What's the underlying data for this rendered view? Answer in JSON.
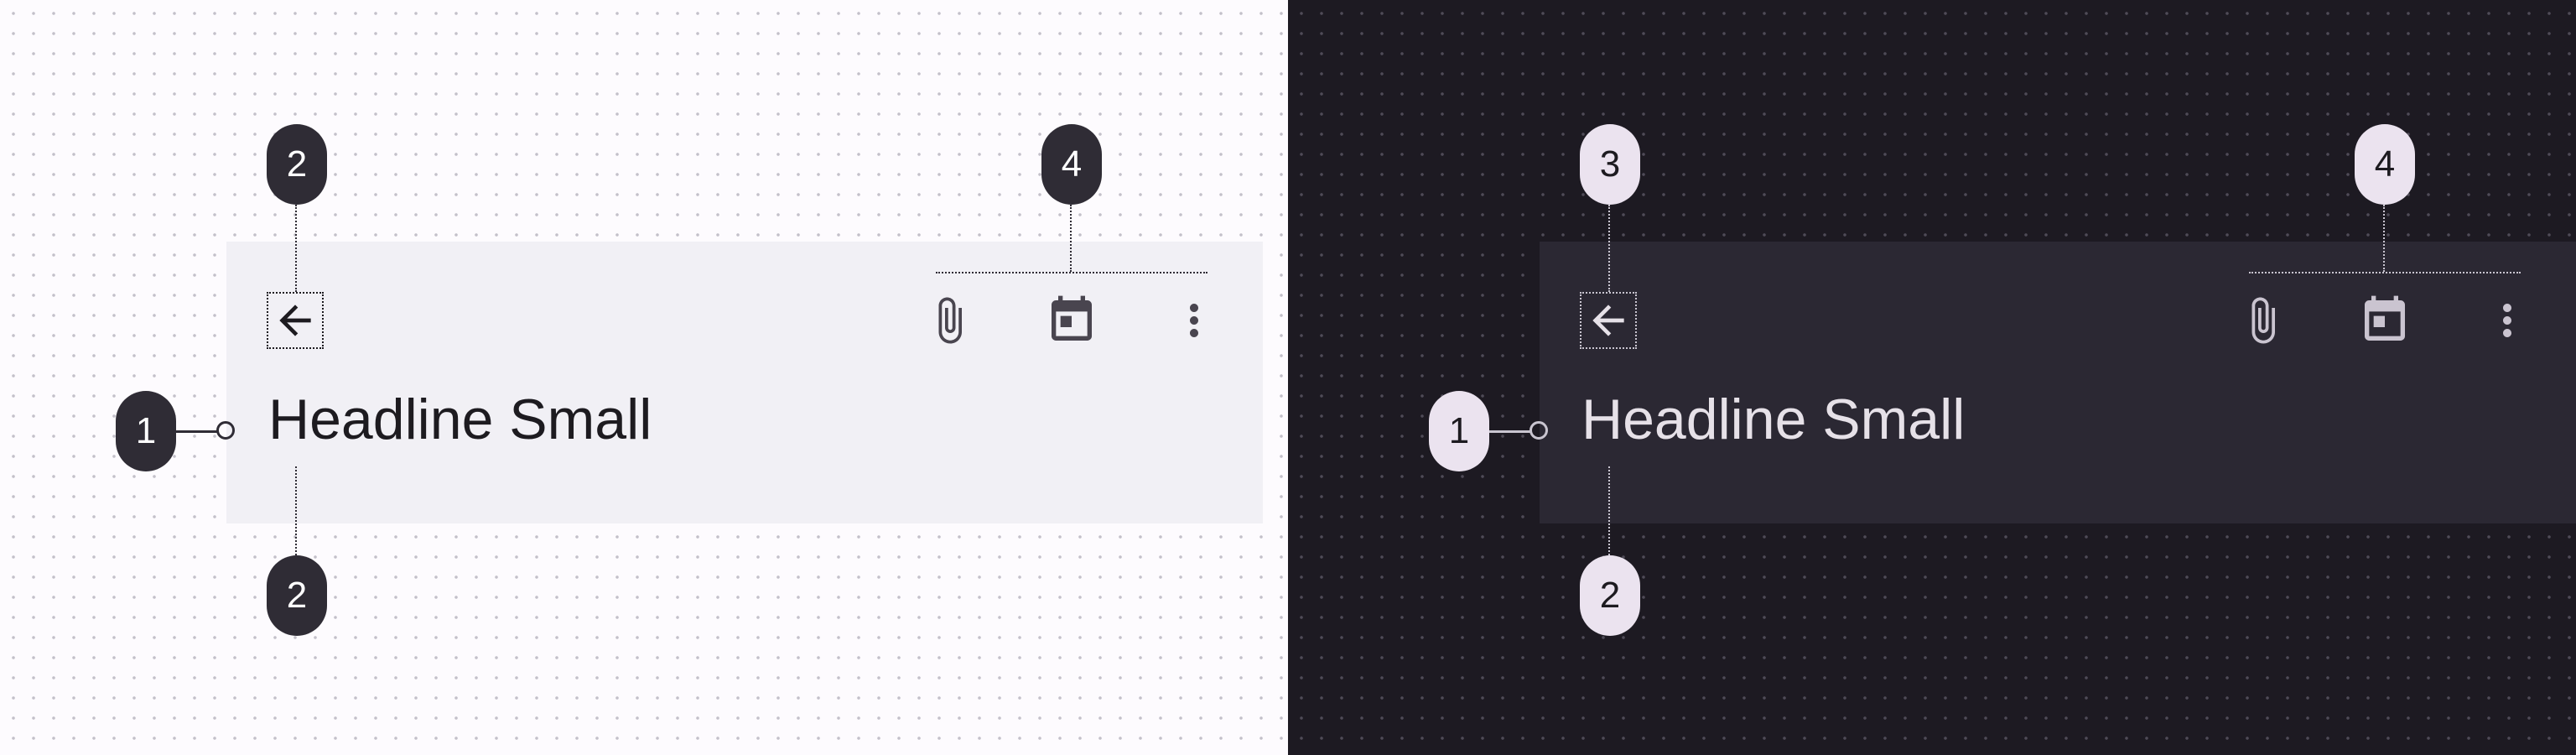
{
  "panels": {
    "light": {
      "headline": "Headline Small",
      "badges": {
        "headline": "1",
        "nav_top": "2",
        "bottom": "2",
        "actions": "4"
      },
      "colors": {
        "background": "#fdfbfe",
        "container": "#f1f0f5",
        "on_surface": "#1d1b20",
        "icon": "#49454f",
        "badge": "#2f2c35"
      }
    },
    "dark": {
      "headline": "Headline Small",
      "badges": {
        "headline": "1",
        "nav_top": "3",
        "bottom": "2",
        "actions": "4"
      },
      "colors": {
        "background": "#1d1a22",
        "container": "#2b2833",
        "on_surface": "#e6e1e8",
        "icon": "#cac4d0",
        "badge": "#ebe3ef"
      }
    }
  },
  "icons": {
    "navigation": "arrow-back-icon",
    "actions": [
      "attachment-icon",
      "calendar-icon",
      "more-vert-icon"
    ]
  }
}
